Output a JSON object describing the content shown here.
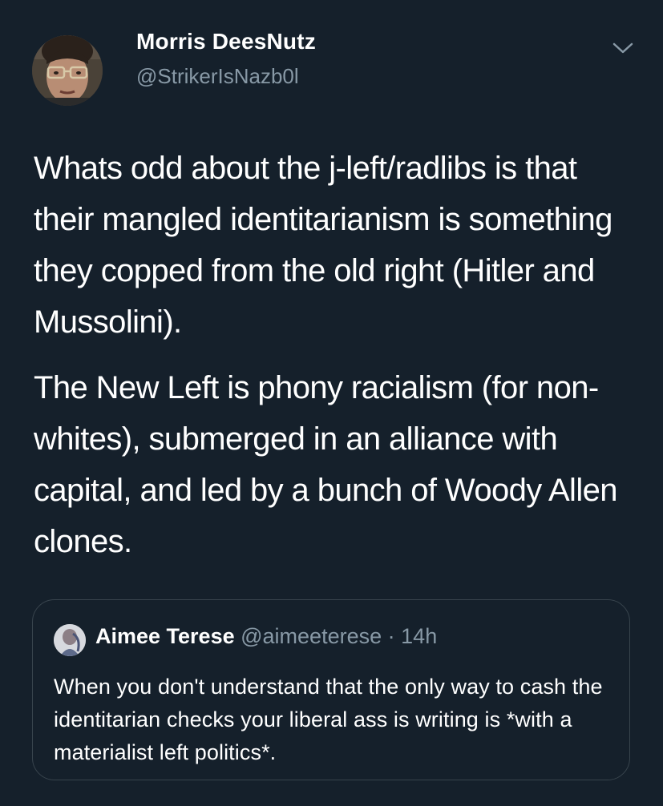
{
  "tweet": {
    "author": {
      "name": "Morris DeesNutz",
      "handle": "@StrikerIsNazb0l"
    },
    "paragraphs": [
      "Whats odd about the j-left/radlibs is that their mangled identitarianism is something they copped from the old right (Hitler and Mussolini).",
      "The New Left is phony racialism (for non-whites), submerged in an alliance with capital, and led by a bunch of Woody Allen clones."
    ],
    "menu_icon": "chevron-down-icon"
  },
  "quoted_tweet": {
    "name": "Aimee Terese",
    "handle": "@aimeeterese",
    "separator": "·",
    "time": "14h",
    "text": "When you don't understand that the only way to cash the identitarian checks your liberal ass is writing is *with a materialist left politics*."
  },
  "colors": {
    "background": "#15202b",
    "text": "#ffffff",
    "secondary_text": "#8899a6",
    "border": "#38444d"
  }
}
